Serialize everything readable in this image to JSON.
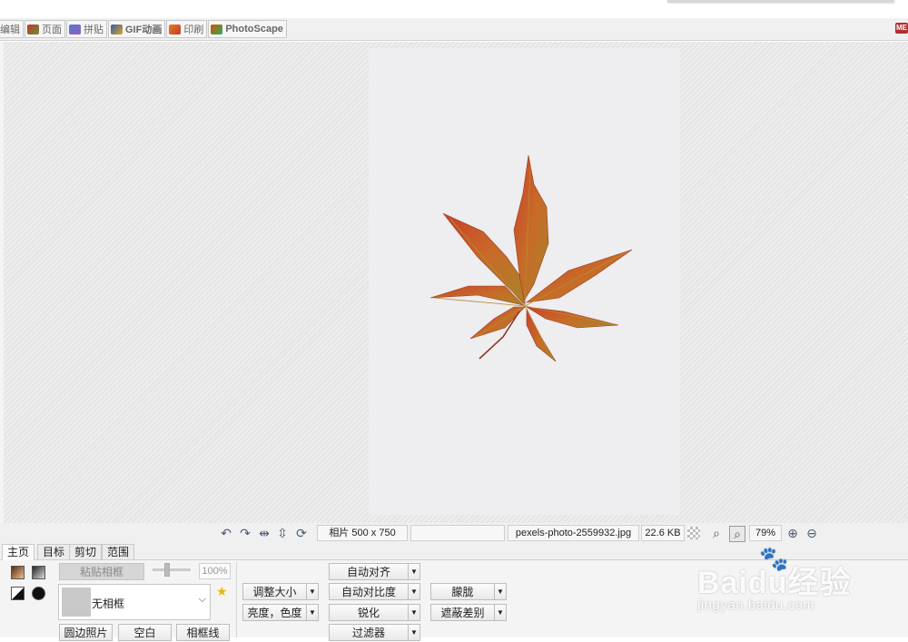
{
  "tabs": [
    {
      "label": "编辑",
      "icon": "edit-icon"
    },
    {
      "label": "页面",
      "icon": "page-icon"
    },
    {
      "label": "拼贴",
      "icon": "collage-icon"
    },
    {
      "label": "GIF动画",
      "icon": "gif-icon"
    },
    {
      "label": "印刷",
      "icon": "print-icon"
    },
    {
      "label": "PhotoScape",
      "icon": "photoscape-icon"
    }
  ],
  "corner_badge": "ME",
  "status": {
    "dimensions": "相片 500 x 750",
    "filename": "pexels-photo-2559932.jpg",
    "filesize": "22.6 KB",
    "zoom": "79%"
  },
  "subtabs": [
    "主页",
    "目标",
    "剪切",
    "范围"
  ],
  "panel": {
    "paste_frame": "粘贴相框",
    "opacity": "100%",
    "frame_value": "无相框",
    "buttons_row3": [
      "圆边照片",
      "空白",
      "相框线"
    ],
    "col1": [
      "调整大小",
      "亮度，色度"
    ],
    "col2": [
      "自动对齐",
      "自动对比度",
      "锐化",
      "过滤器"
    ],
    "col3": [
      "朦胧",
      "遮蔽差别"
    ]
  },
  "watermark": {
    "main": "Baidu经验",
    "sub": "jingyan.baidu.com"
  },
  "colors": {
    "accent_leaf": "#c0502a",
    "canvas": "#e6e6e6"
  }
}
